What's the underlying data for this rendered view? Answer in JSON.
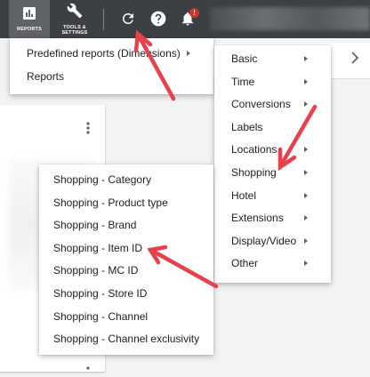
{
  "topbar": {
    "reports_label": "REPORTS",
    "tools_label_line1": "TOOLS &",
    "tools_label_line2": "SETTINGS",
    "notification_badge": "!"
  },
  "icons": {
    "reports": "bar-chart-icon",
    "tools": "wrench-icon",
    "refresh": "refresh-icon",
    "help": "help-icon",
    "notifications": "bell-icon"
  },
  "predefined_menu": {
    "items": [
      {
        "label": "Predefined reports (Dimensions)",
        "has_submenu": true
      },
      {
        "label": "Reports",
        "has_submenu": false
      }
    ]
  },
  "dimensions_menu": {
    "items": [
      {
        "label": "Basic",
        "has_submenu": true
      },
      {
        "label": "Time",
        "has_submenu": true
      },
      {
        "label": "Conversions",
        "has_submenu": true
      },
      {
        "label": "Labels",
        "has_submenu": false
      },
      {
        "label": "Locations",
        "has_submenu": true
      },
      {
        "label": "Shopping",
        "has_submenu": true
      },
      {
        "label": "Hotel",
        "has_submenu": true
      },
      {
        "label": "Extensions",
        "has_submenu": true
      },
      {
        "label": "Display/Video",
        "has_submenu": true
      },
      {
        "label": "Other",
        "has_submenu": true
      }
    ]
  },
  "shopping_menu": {
    "items": [
      {
        "label": "Shopping - Category"
      },
      {
        "label": "Shopping - Product type"
      },
      {
        "label": "Shopping - Brand"
      },
      {
        "label": "Shopping - Item ID"
      },
      {
        "label": "Shopping - MC ID"
      },
      {
        "label": "Shopping - Store ID"
      },
      {
        "label": "Shopping - Channel"
      },
      {
        "label": "Shopping - Channel exclusivity"
      }
    ]
  },
  "colors": {
    "topbar": "#3c4043",
    "annotation_arrow": "#e8414b",
    "badge": "#d93025"
  }
}
